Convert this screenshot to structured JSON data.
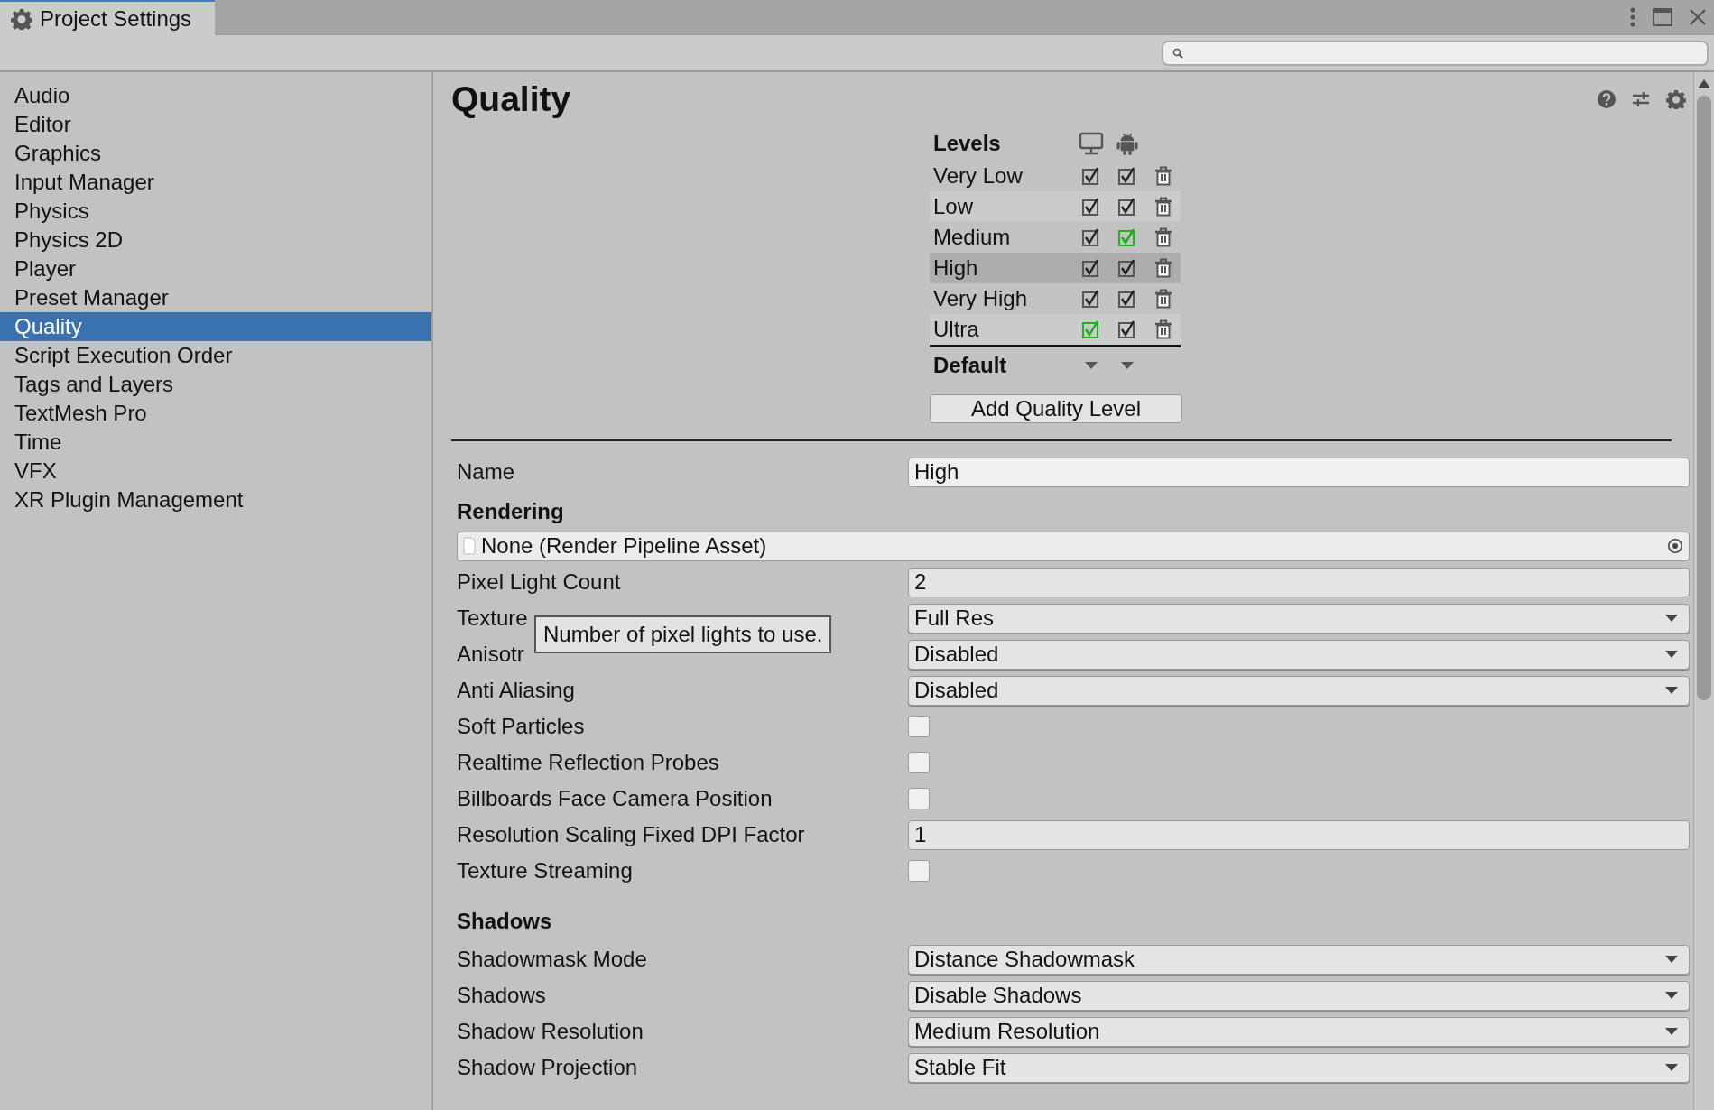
{
  "window": {
    "title": "Project Settings"
  },
  "sidebar": {
    "items": [
      {
        "label": "Audio",
        "selected": false
      },
      {
        "label": "Editor",
        "selected": false
      },
      {
        "label": "Graphics",
        "selected": false
      },
      {
        "label": "Input Manager",
        "selected": false
      },
      {
        "label": "Physics",
        "selected": false
      },
      {
        "label": "Physics 2D",
        "selected": false
      },
      {
        "label": "Player",
        "selected": false
      },
      {
        "label": "Preset Manager",
        "selected": false
      },
      {
        "label": "Quality",
        "selected": true
      },
      {
        "label": "Script Execution Order",
        "selected": false
      },
      {
        "label": "Tags and Layers",
        "selected": false
      },
      {
        "label": "TextMesh Pro",
        "selected": false
      },
      {
        "label": "Time",
        "selected": false
      },
      {
        "label": "VFX",
        "selected": false
      },
      {
        "label": "XR Plugin Management",
        "selected": false
      }
    ]
  },
  "page": {
    "title": "Quality"
  },
  "levels": {
    "title": "Levels",
    "default_label": "Default",
    "add_button": "Add Quality Level",
    "rows": [
      {
        "name": "Very Low",
        "selected": false,
        "desktop": {
          "checked": true,
          "default": false
        },
        "android": {
          "checked": true,
          "default": false
        }
      },
      {
        "name": "Low",
        "selected": false,
        "desktop": {
          "checked": true,
          "default": false
        },
        "android": {
          "checked": true,
          "default": false
        }
      },
      {
        "name": "Medium",
        "selected": false,
        "desktop": {
          "checked": true,
          "default": false
        },
        "android": {
          "checked": true,
          "default": true
        }
      },
      {
        "name": "High",
        "selected": true,
        "desktop": {
          "checked": true,
          "default": false
        },
        "android": {
          "checked": true,
          "default": false
        }
      },
      {
        "name": "Very High",
        "selected": false,
        "desktop": {
          "checked": true,
          "default": false
        },
        "android": {
          "checked": true,
          "default": false
        }
      },
      {
        "name": "Ultra",
        "selected": false,
        "desktop": {
          "checked": true,
          "default": true
        },
        "android": {
          "checked": true,
          "default": false
        }
      }
    ]
  },
  "properties": [
    {
      "kind": "text",
      "label": "Name",
      "value": "High"
    },
    {
      "kind": "heading",
      "label": "Rendering"
    },
    {
      "kind": "object",
      "value": "None (Render Pipeline Asset)"
    },
    {
      "kind": "text",
      "label": "Pixel Light Count",
      "value": "2"
    },
    {
      "kind": "dropdown",
      "label": "Texture",
      "value": "Full Res"
    },
    {
      "kind": "dropdown",
      "label": "Anisotr",
      "value": "Disabled"
    },
    {
      "kind": "dropdown",
      "label": "Anti Aliasing",
      "value": "Disabled"
    },
    {
      "kind": "checkbox",
      "label": "Soft Particles",
      "checked": false
    },
    {
      "kind": "checkbox",
      "label": "Realtime Reflection Probes",
      "checked": false
    },
    {
      "kind": "checkbox",
      "label": "Billboards Face Camera Position",
      "checked": false
    },
    {
      "kind": "text",
      "label": "Resolution Scaling Fixed DPI Factor",
      "value": "1"
    },
    {
      "kind": "checkbox",
      "label": "Texture Streaming",
      "checked": false
    },
    {
      "kind": "heading",
      "label": "Shadows"
    },
    {
      "kind": "dropdown",
      "label": "Shadowmask Mode",
      "value": "Distance Shadowmask"
    },
    {
      "kind": "dropdown",
      "label": "Shadows",
      "value": "Disable Shadows"
    },
    {
      "kind": "dropdown",
      "label": "Shadow Resolution",
      "value": "Medium Resolution"
    },
    {
      "kind": "dropdown",
      "label": "Shadow Projection",
      "value": "Stable Fit"
    }
  ],
  "tooltip": {
    "text": "Number of pixel lights to use."
  }
}
